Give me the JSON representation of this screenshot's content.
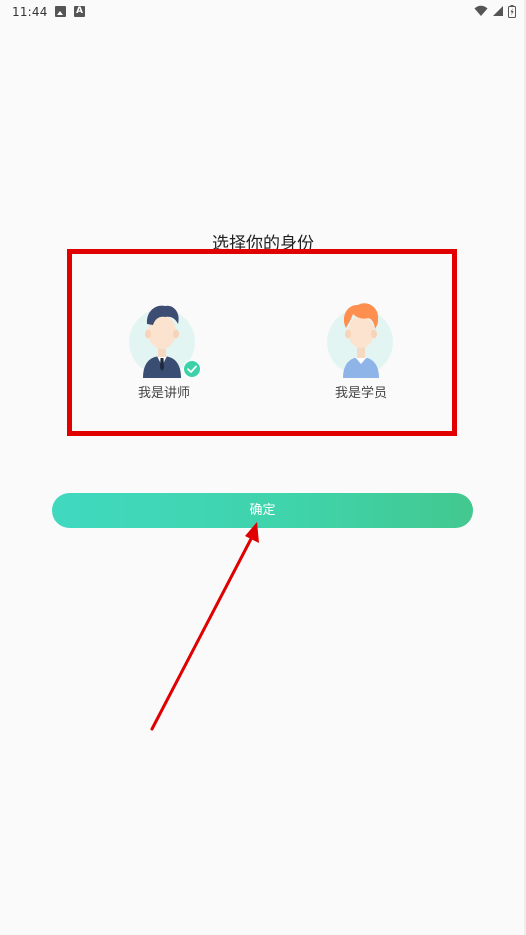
{
  "status_bar": {
    "time": "11:44",
    "icons": [
      "image-icon",
      "a-icon",
      "wifi-icon",
      "signal-icon",
      "battery-icon"
    ]
  },
  "page": {
    "title": "选择你的身份"
  },
  "roles": [
    {
      "label": "我是讲师",
      "selected": true,
      "icon": "teacher-avatar-icon"
    },
    {
      "label": "我是学员",
      "selected": false,
      "icon": "student-avatar-icon"
    }
  ],
  "confirm": {
    "label": "确定"
  },
  "colors": {
    "accent_start": "#40d9c0",
    "accent_end": "#43c88f",
    "highlight_red": "#e00000",
    "check_green": "#3cd1a8"
  }
}
